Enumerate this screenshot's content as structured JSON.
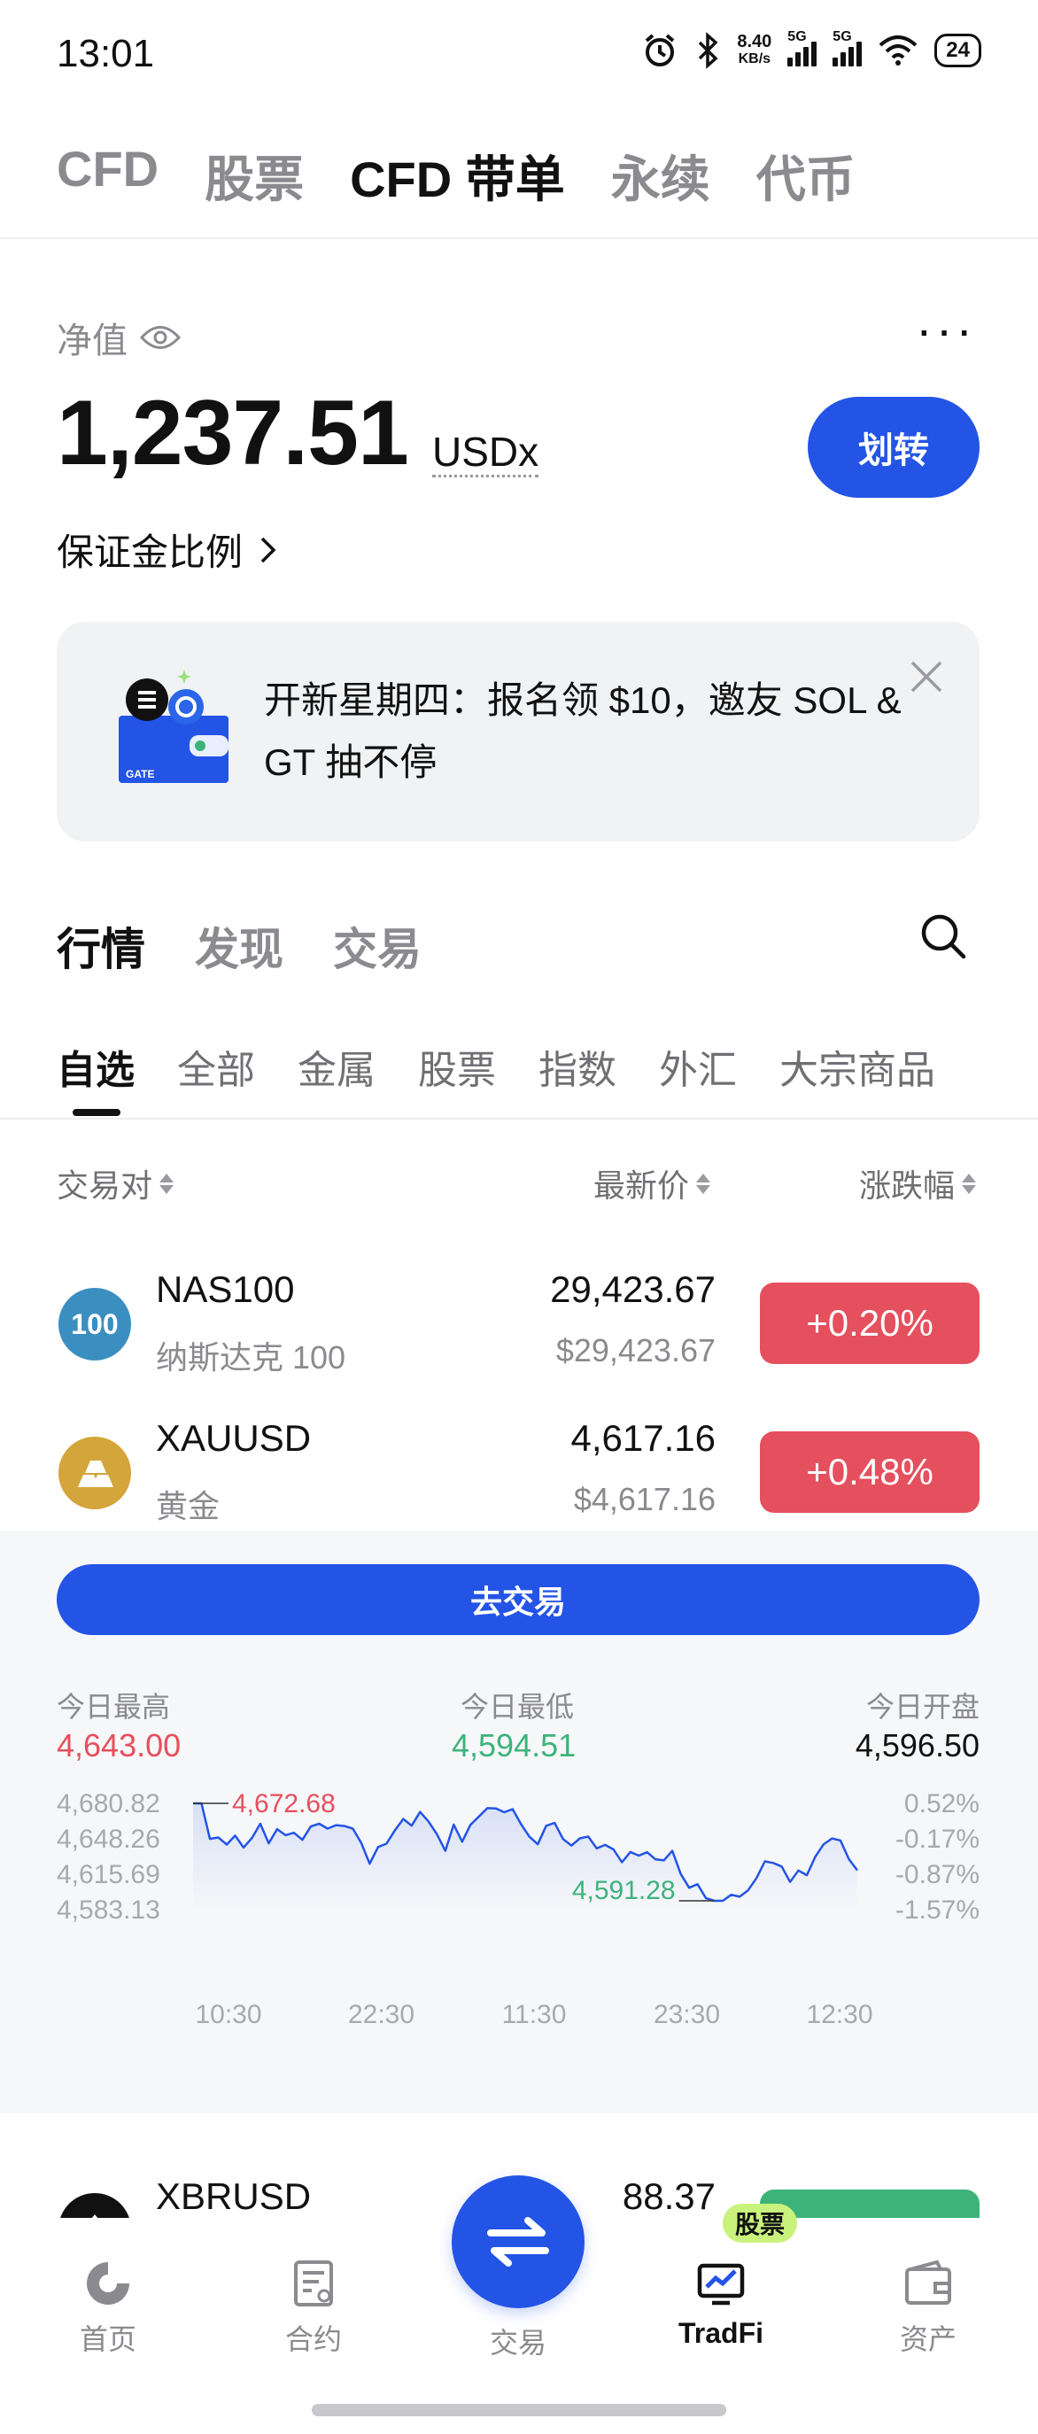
{
  "status_bar": {
    "time": "13:01",
    "net_speed_value": "8.40",
    "net_speed_unit": "KB/s",
    "sim1_label": "5G",
    "sim2_label": "5G",
    "battery": "24",
    "icons": [
      "alarm-icon",
      "bluetooth-icon",
      "signal-icon",
      "wifi-icon",
      "battery-icon"
    ]
  },
  "top_tabs": [
    {
      "label": "CFD",
      "active": false
    },
    {
      "label": "股票",
      "active": false
    },
    {
      "label": "CFD 带单",
      "active": true
    },
    {
      "label": "永续",
      "active": false
    },
    {
      "label": "代币",
      "active": false
    }
  ],
  "account": {
    "net_value_label": "净值",
    "net_value": "1,237.51",
    "unit": "USDx",
    "transfer_label": "划转",
    "margin_ratio_label": "保证金比例"
  },
  "banner": {
    "text": "开新星期四：报名领 $10，邀友 SOL & GT 抽不停",
    "wallet_brand": "GATE"
  },
  "section_tabs": [
    {
      "label": "行情",
      "active": true
    },
    {
      "label": "发现",
      "active": false
    },
    {
      "label": "交易",
      "active": false
    }
  ],
  "category_tabs": [
    {
      "label": "自选",
      "active": true
    },
    {
      "label": "全部",
      "active": false
    },
    {
      "label": "金属",
      "active": false
    },
    {
      "label": "股票",
      "active": false
    },
    {
      "label": "指数",
      "active": false
    },
    {
      "label": "外汇",
      "active": false
    },
    {
      "label": "大宗商品",
      "active": false
    }
  ],
  "table_headers": {
    "pair": "交易对",
    "last_price": "最新价",
    "change": "涨跌幅"
  },
  "rows": [
    {
      "icon_text": "100",
      "icon_color": "#3b8fc0",
      "symbol": "NAS100",
      "name": "纳斯达克 100",
      "price": "29,423.67",
      "fiat": "$29,423.67",
      "change": "+0.20%"
    },
    {
      "icon_text": "",
      "icon_color": "#d4a53a",
      "symbol": "XAUUSD",
      "name": "黄金",
      "price": "4,617.16",
      "fiat": "$4,617.16",
      "change": "+0.48%"
    }
  ],
  "expanded": {
    "go_trade_label": "去交易",
    "high_label": "今日最高",
    "high_value": "4,643.00",
    "low_label": "今日最低",
    "low_value": "4,594.51",
    "open_label": "今日开盘",
    "open_value": "4,596.50",
    "colors": {
      "up": "#e5505e",
      "down": "#3db37a",
      "line": "#2354e6"
    }
  },
  "chart_data": {
    "type": "line",
    "x": [
      "10:30",
      "22:30",
      "11:30",
      "23:30",
      "12:30"
    ],
    "y_ticks_left": [
      "4,680.82",
      "4,648.26",
      "4,615.69",
      "4,583.13"
    ],
    "y_ticks_right": [
      "0.52%",
      "-0.17%",
      "-0.87%",
      "-1.57%"
    ],
    "ylim": [
      4583.13,
      4680.82
    ],
    "max_label": "4,672.68",
    "min_label": "4,591.28",
    "values": [
      4680.8,
      4680.8,
      4648.2,
      4649.5,
      4643.0,
      4651.2,
      4640.2,
      4649.0,
      4662.1,
      4644.1,
      4657.1,
      4651.6,
      4653.8,
      4647.3,
      4659.6,
      4662.1,
      4657.6,
      4660.8,
      4660.0,
      4657.6,
      4644.4,
      4625.4,
      4640.7,
      4643.8,
      4655.9,
      4666.5,
      4660.3,
      4672.9,
      4664.2,
      4652.5,
      4637.2,
      4661.3,
      4645.6,
      4661.2,
      4668.8,
      4676.4,
      4676.2,
      4672.7,
      4675.5,
      4661.7,
      4650.2,
      4643.2,
      4660.2,
      4662.8,
      4648.1,
      4642.0,
      4648.7,
      4650.3,
      4639.5,
      4642.6,
      4638.5,
      4626.7,
      4636.1,
      4632.8,
      4635.9,
      4629.3,
      4628.5,
      4637.2,
      4615.9,
      4603.2,
      4606.5,
      4593.6,
      4591.3,
      4591.3,
      4596.8,
      4595.0,
      4600.9,
      4612.1,
      4627.5,
      4626.0,
      4622.8,
      4608.6,
      4619.1,
      4614.8,
      4631.7,
      4643.3,
      4648.6,
      4646.6,
      4629.5,
      4619.3
    ]
  },
  "partial_row": {
    "symbol": "XBRUSD",
    "price": "88.37",
    "change_color": "#3db37a"
  },
  "bottom_nav": [
    {
      "label": "首页",
      "icon": "home-icon",
      "active": false
    },
    {
      "label": "合约",
      "icon": "contract-icon",
      "active": false
    },
    {
      "label": "交易",
      "icon": "swap-icon",
      "active": false
    },
    {
      "label": "TradFi",
      "icon": "tradfi-icon",
      "active": true,
      "badge": "股票"
    },
    {
      "label": "资产",
      "icon": "wallet-icon",
      "active": false
    }
  ]
}
